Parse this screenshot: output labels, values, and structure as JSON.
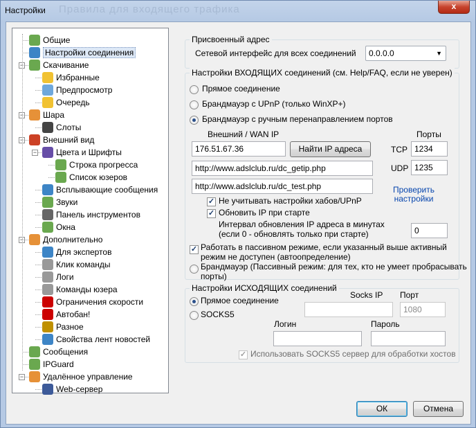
{
  "window": {
    "title": "Настройки",
    "ghost_title": "Правила для входящего трафика",
    "close_label": "x"
  },
  "tree": {
    "items": [
      {
        "label": "Общие",
        "icon": "general-icon",
        "color": "#6aa84f"
      },
      {
        "label": "Настройки соединения",
        "icon": "globe-icon",
        "color": "#3d85c6"
      },
      {
        "label": "Скачивание",
        "icon": "download-icon",
        "color": "#6aa84f"
      },
      {
        "label": "Избранные",
        "icon": "star-icon",
        "color": "#f1c232"
      },
      {
        "label": "Предпросмотр",
        "icon": "magnifier-icon",
        "color": "#6fa8dc"
      },
      {
        "label": "Очередь",
        "icon": "warning-icon",
        "color": "#f1c232"
      },
      {
        "label": "Шара",
        "icon": "share-icon",
        "color": "#e69138"
      },
      {
        "label": "Слоты",
        "icon": "bars-icon",
        "color": "#444444"
      },
      {
        "label": "Внешний вид",
        "icon": "appearance-icon",
        "color": "#cc4125"
      },
      {
        "label": "Цвета и Шрифты",
        "icon": "palette-icon",
        "color": "#674ea7"
      },
      {
        "label": "Строка прогресса",
        "icon": "progress-icon",
        "color": "#6aa84f"
      },
      {
        "label": "Список юзеров",
        "icon": "users-icon",
        "color": "#6aa84f"
      },
      {
        "label": "Всплывающие сообщения",
        "icon": "popup-icon",
        "color": "#3d85c6"
      },
      {
        "label": "Звуки",
        "icon": "note-icon",
        "color": "#6aa84f"
      },
      {
        "label": "Панель инструментов",
        "icon": "hammer-icon",
        "color": "#666666"
      },
      {
        "label": "Окна",
        "icon": "windows-icon",
        "color": "#6aa84f"
      },
      {
        "label": "Дополнительно",
        "icon": "advanced-icon",
        "color": "#e69138"
      },
      {
        "label": "Для экспертов",
        "icon": "expert-icon",
        "color": "#3d85c6"
      },
      {
        "label": "Клик команды",
        "icon": "mouse-icon",
        "color": "#999999"
      },
      {
        "label": "Логи",
        "icon": "log-icon",
        "color": "#999999"
      },
      {
        "label": "Команды юзера",
        "icon": "user-commands-icon",
        "color": "#999999"
      },
      {
        "label": "Ограничения скорости",
        "icon": "speed-limit-icon",
        "color": "#cc0000"
      },
      {
        "label": "Автобан!",
        "icon": "ban-icon",
        "color": "#cc0000"
      },
      {
        "label": "Разное",
        "icon": "lock-icon",
        "color": "#bf9000"
      },
      {
        "label": "Свойства лент новостей",
        "icon": "rss-icon",
        "color": "#3d85c6"
      },
      {
        "label": "Сообщения",
        "icon": "messages-icon",
        "color": "#6aa84f"
      },
      {
        "label": "IPGuard",
        "icon": "ipguard-icon",
        "color": "#6aa84f"
      },
      {
        "label": "Удалённое управление",
        "icon": "remote-icon",
        "color": "#e69138"
      },
      {
        "label": "Web-сервер",
        "icon": "webserver-icon",
        "color": "#3d5a99"
      }
    ]
  },
  "assigned_address": {
    "group_title": "Присвоенный адрес",
    "iface_label": "Сетевой интерфейс для всех соединений",
    "iface_value": "0.0.0.0"
  },
  "incoming": {
    "group_title": "Настройки ВХОДЯЩИХ соединений (см. Help/FAQ, если не уверен)",
    "direct": "Прямое соединение",
    "upnp": "Брандмауэр с UPnP (только WinXP+)",
    "manual": "Брандмауэр с ручным перенаправлением портов",
    "wan_label": "Внешний / WAN IP",
    "ports_label": "Порты",
    "wan_ip": "176.51.67.36",
    "find_ip_button": "Найти IP адреса",
    "tcp_label": "TCP",
    "tcp_port": "1234",
    "udp_label": "UDP",
    "udp_port": "1235",
    "getip_url": "http://www.adslclub.ru/dc_getip.php",
    "test_url": "http://www.adslclub.ru/dc_test.php",
    "check_link": "Проверить настройки",
    "ignore_hubs": "Не учитывать настройки хабов/UPnP",
    "update_ip": "Обновить IP при старте",
    "interval_label_1": "Интервал обновления IP адреса в минутах",
    "interval_label_2": "(если 0 - обновлять только при старте)",
    "interval_value": "0",
    "passive_fallback_1": "Работать в пассивном режиме, если указанный выше активный",
    "passive_fallback_2": "режим не доступен (автоопределение)",
    "passive_1": "Брандмауэр (Пассивный режим: для тех, кто не умеет пробрасывать",
    "passive_2": "порты)"
  },
  "outgoing": {
    "group_title": "Настройки ИСХОДЯЩИХ соединений",
    "direct": "Прямое соединение",
    "socks5": "SOCKS5",
    "socks_ip_label": "Socks IP",
    "port_label": "Порт",
    "port_placeholder": "1080",
    "login_label": "Логин",
    "password_label": "Пароль",
    "use_socks_hosts": "Использовать SOCKS5 сервер для обработки хостов"
  },
  "buttons": {
    "ok": "ОК",
    "cancel": "Отмена"
  }
}
